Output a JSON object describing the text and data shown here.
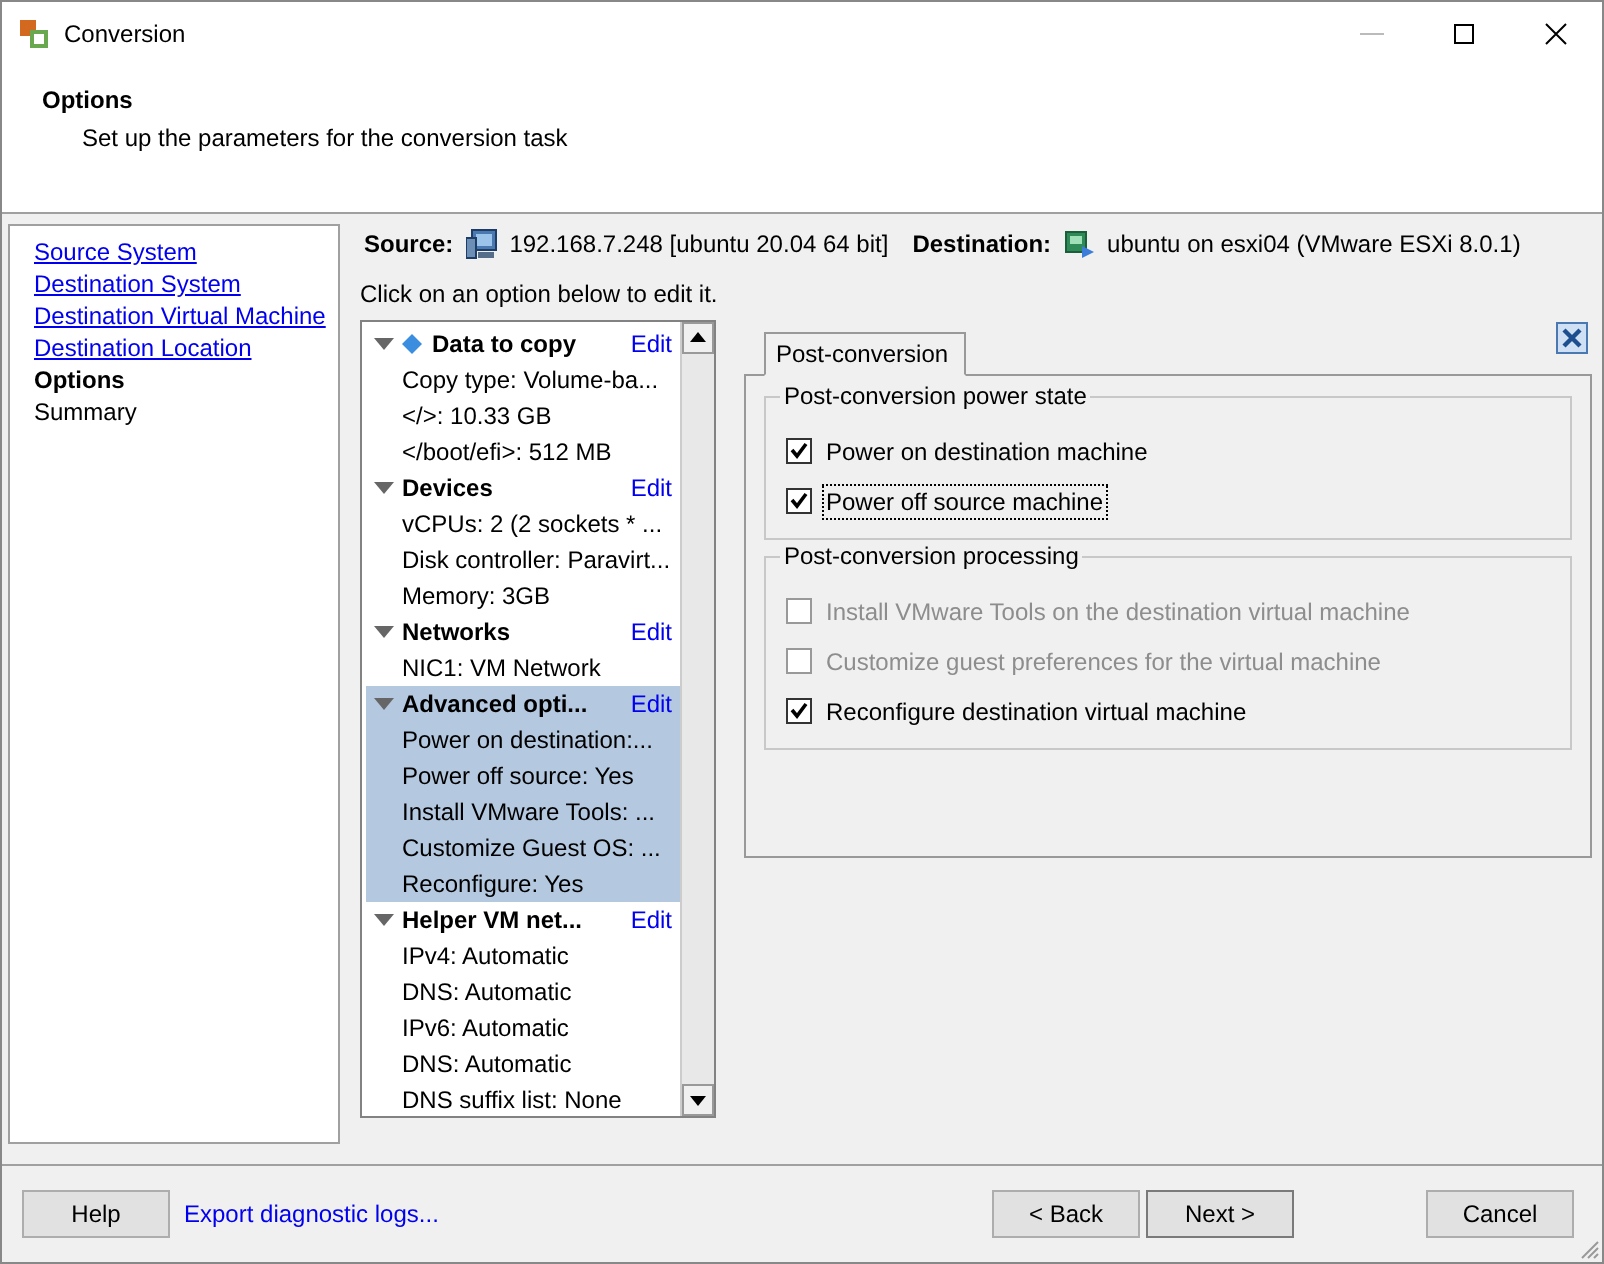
{
  "window": {
    "title": "Conversion"
  },
  "header": {
    "title": "Options",
    "subtitle": "Set up the parameters for the conversion task"
  },
  "steps": [
    {
      "label": "Source System",
      "selected": false,
      "enabled": true
    },
    {
      "label": "Destination System",
      "selected": false,
      "enabled": true
    },
    {
      "label": "Destination Virtual Machine",
      "selected": false,
      "enabled": true
    },
    {
      "label": "Destination Location",
      "selected": false,
      "enabled": true
    },
    {
      "label": "Options",
      "selected": true,
      "enabled": true
    },
    {
      "label": "Summary",
      "selected": false,
      "enabled": false
    }
  ],
  "summary": {
    "source_label": "Source:",
    "source": "192.168.7.248 [ubuntu 20.04 64 bit]",
    "destination_label": "Destination:",
    "destination": "ubuntu on esxi04 (VMware ESXi 8.0.1)"
  },
  "hint": "Click on an option below to edit it.",
  "sections": [
    {
      "title": "Data to copy",
      "edit": "Edit",
      "selected": false,
      "marked": true,
      "items": [
        "Copy type: Volume-ba...",
        "</>: 10.33 GB",
        "</boot/efi>: 512 MB"
      ]
    },
    {
      "title": "Devices",
      "edit": "Edit",
      "selected": false,
      "marked": false,
      "items": [
        "vCPUs: 2 (2 sockets * ...",
        "Disk controller: Paravirt...",
        "Memory: 3GB"
      ]
    },
    {
      "title": "Networks",
      "edit": "Edit",
      "selected": false,
      "marked": false,
      "items": [
        "NIC1: VM Network"
      ]
    },
    {
      "title": "Advanced opti...",
      "edit": "Edit",
      "selected": true,
      "marked": false,
      "items": [
        "Power on destination:...",
        "Power off source: Yes",
        "Install VMware Tools: ...",
        "Customize Guest OS: ...",
        "Reconfigure: Yes"
      ]
    },
    {
      "title": "Helper VM net...",
      "edit": "Edit",
      "selected": false,
      "marked": false,
      "items": [
        "IPv4: Automatic",
        "DNS: Automatic",
        "IPv6: Automatic",
        "DNS: Automatic",
        "DNS suffix list: None"
      ]
    }
  ],
  "tabs": [
    {
      "label": "Post-conversion",
      "selected": true
    }
  ],
  "groups": [
    {
      "title": "Post-conversion power state",
      "options": [
        {
          "label": "Power on destination machine",
          "checked": true,
          "disabled": false,
          "focused": false
        },
        {
          "label": "Power off source machine",
          "checked": true,
          "disabled": false,
          "focused": true
        }
      ]
    },
    {
      "title": "Post-conversion processing",
      "options": [
        {
          "label": "Install VMware Tools on the destination virtual machine",
          "checked": false,
          "disabled": true,
          "focused": false
        },
        {
          "label": "Customize guest preferences for the virtual machine",
          "checked": false,
          "disabled": true,
          "focused": false
        },
        {
          "label": "Reconfigure destination virtual machine",
          "checked": true,
          "disabled": false,
          "focused": false
        }
      ]
    }
  ],
  "footer": {
    "help": "Help",
    "export": "Export diagnostic logs...",
    "back": "< Back",
    "next": "Next >",
    "cancel": "Cancel"
  }
}
